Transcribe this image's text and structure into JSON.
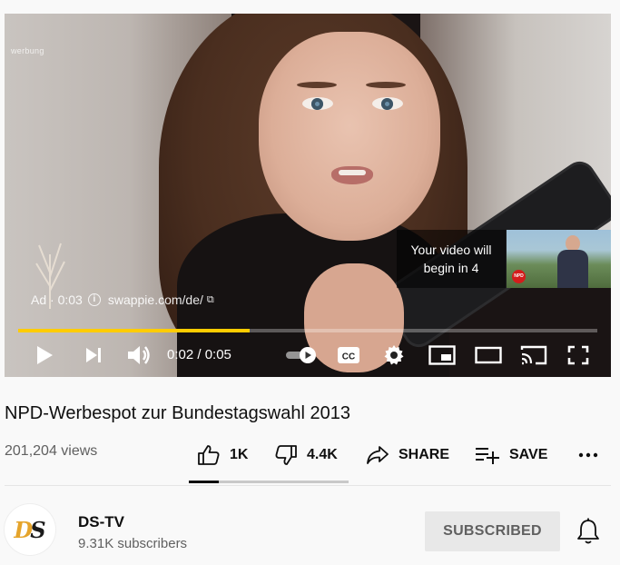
{
  "player": {
    "ad_watermark": "werbung",
    "ad_badge": "Ad · 0:03",
    "ad_url": "swappie.com/de/",
    "upnext_text": "Your video will begin in 4",
    "upnext_thumb_logo": "NPD",
    "progress_played_fraction": 0.4,
    "progress_loaded_fraction": 0.4,
    "time_display": "0:02 / 0:05",
    "progress_color": "#ffcc00",
    "icons": [
      "play-icon",
      "next-icon",
      "volume-icon",
      "autoplay-toggle",
      "captions-icon",
      "settings-icon",
      "miniplayer-icon",
      "theater-icon",
      "cast-icon",
      "fullscreen-icon"
    ]
  },
  "video": {
    "title": "NPD-Werbespot zur Bundestagswahl 2013",
    "views": "201,204 views",
    "like_count": "1K",
    "dislike_count": "4.4K",
    "share_label": "SHARE",
    "save_label": "SAVE",
    "like_fraction": 0.185
  },
  "channel": {
    "name": "DS-TV",
    "subscribers": "9.31K subscribers",
    "logo_letters": [
      "D",
      "S"
    ],
    "subscribe_label": "SUBSCRIBED"
  }
}
